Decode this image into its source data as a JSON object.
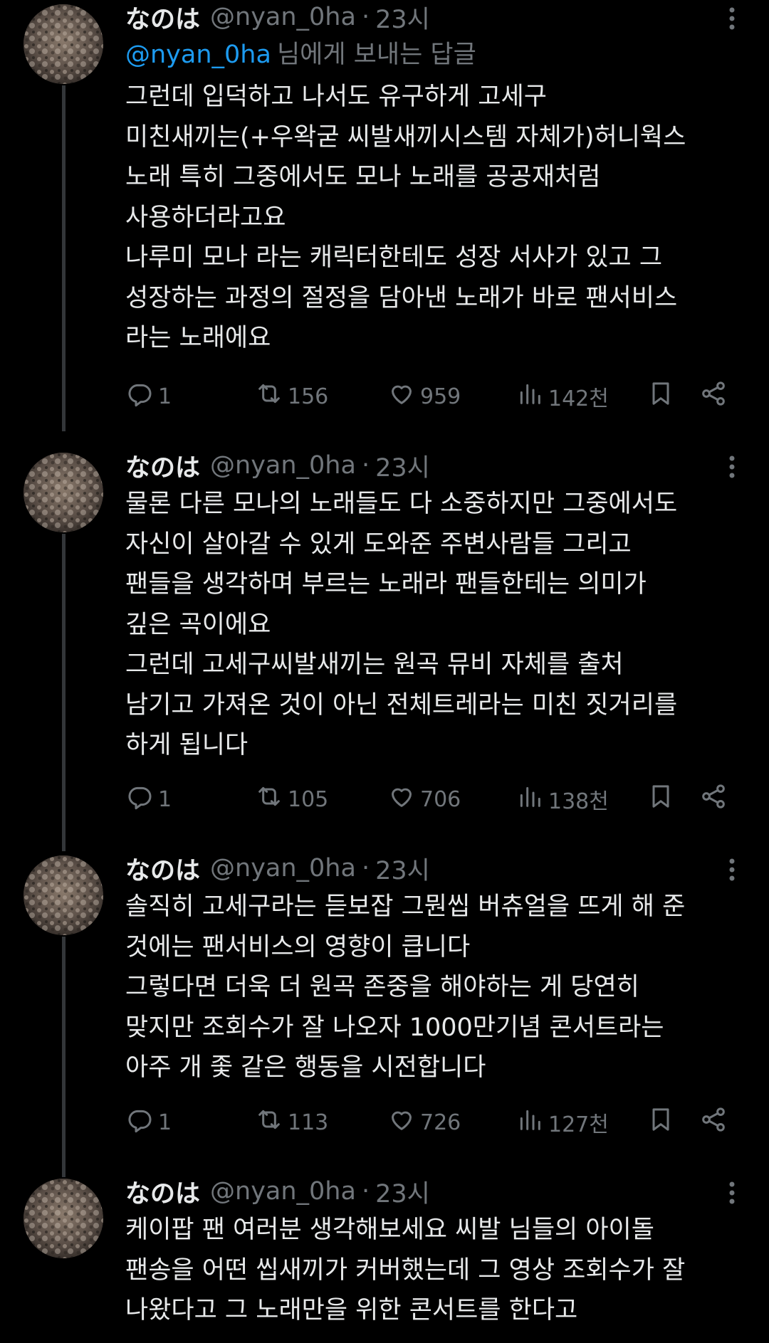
{
  "colors": {
    "background": "#000000",
    "text": "#e7e9ea",
    "muted": "#71767b",
    "accent": "#1d9bf0",
    "thread_line": "#333639"
  },
  "tweets": [
    {
      "name": "なのは",
      "handle": "@nyan_0ha",
      "time": "23시",
      "reply_to": {
        "mention": "@nyan_0ha",
        "suffix": "님에게 보내는 답글"
      },
      "lines": [
        "그런데 입덕하고 나서도 유구하게 고세구",
        "미친새끼는(+우왁굳 씨발새끼시스템 자체가)허니웍스",
        "노래 특히 그중에서도 모나 노래를 공공재처럼",
        "사용하더라고요",
        "나루미 모나 라는 캐릭터한테도 성장 서사가 있고 그",
        "성장하는 과정의 절정을 담아낸 노래가 바로 팬서비스",
        "라는 노래에요"
      ],
      "replies": "1",
      "reposts": "156",
      "likes": "959",
      "views": "142천"
    },
    {
      "name": "なのは",
      "handle": "@nyan_0ha",
      "time": "23시",
      "lines": [
        "물론 다른 모나의 노래들도 다 소중하지만 그중에서도",
        "자신이 살아갈 수 있게 도와준 주변사람들 그리고",
        "팬들을 생각하며 부르는 노래라 팬들한테는 의미가",
        "깊은 곡이에요",
        "그런데 고세구씨발새끼는 원곡 뮤비 자체를 출처",
        "남기고 가져온 것이 아닌 전체트레라는 미친 짓거리를",
        "하게 됩니다"
      ],
      "replies": "1",
      "reposts": "105",
      "likes": "706",
      "views": "138천"
    },
    {
      "name": "なのは",
      "handle": "@nyan_0ha",
      "time": "23시",
      "lines": [
        "솔직히 고세구라는 듣보잡 그뭔씹 버츄얼을 뜨게 해 준",
        "것에는 팬서비스의 영향이 큽니다",
        "그렇다면 더욱 더 원곡 존중을 해야하는 게 당연히",
        "맞지만 조회수가 잘 나오자 1000만기념 콘서트라는",
        "아주 개 좇 같은 행동을 시전합니다"
      ],
      "replies": "1",
      "reposts": "113",
      "likes": "726",
      "views": "127천"
    },
    {
      "name": "なのは",
      "handle": "@nyan_0ha",
      "time": "23시",
      "lines": [
        "케이팝 팬 여러분 생각해보세요 씨발 님들의 아이돌",
        "팬송을 어떤 씹새끼가 커버했는데 그 영상 조회수가 잘",
        "나왔다고 그 노래만을 위한 콘서트를 한다고"
      ]
    }
  ]
}
